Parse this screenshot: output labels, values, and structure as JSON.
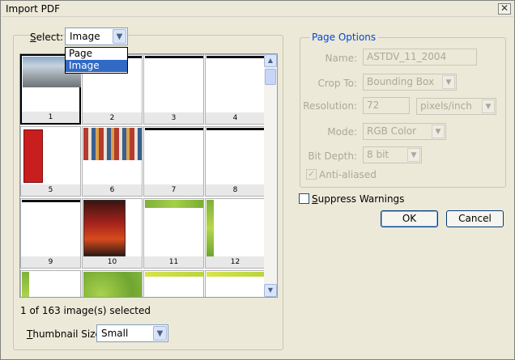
{
  "window": {
    "title": "Import PDF",
    "close_glyph": "✕"
  },
  "select": {
    "label_prefix": "",
    "label_underlined": "S",
    "label_rest": "elect:",
    "value": "Image",
    "options": [
      "Page",
      "Image"
    ],
    "selected_index": 1
  },
  "thumbnails": [
    {
      "num": "1",
      "kind": "photo-building",
      "selected": true
    },
    {
      "num": "2",
      "kind": "blank-bar"
    },
    {
      "num": "3",
      "kind": "blank-bar"
    },
    {
      "num": "4",
      "kind": "blank-bar"
    },
    {
      "num": "5",
      "kind": "red-door"
    },
    {
      "num": "6",
      "kind": "photo-market"
    },
    {
      "num": "7",
      "kind": "blank-bar"
    },
    {
      "num": "8",
      "kind": "blank-bar"
    },
    {
      "num": "9",
      "kind": "blank-bar"
    },
    {
      "num": "10",
      "kind": "poster"
    },
    {
      "num": "11",
      "kind": "green-top"
    },
    {
      "num": "12",
      "kind": "green-left"
    },
    {
      "num": "",
      "kind": "green-left"
    },
    {
      "num": "",
      "kind": "green-full"
    },
    {
      "num": "",
      "kind": "yellow-top"
    },
    {
      "num": "",
      "kind": "yellow-top"
    }
  ],
  "status": "1 of 163 image(s) selected",
  "thumbnail_size": {
    "label_underlined": "T",
    "label_rest": "humbnail Size:",
    "value": "Small"
  },
  "page_options": {
    "legend": "Page Options",
    "name_label": "Name:",
    "name_value": "ASTDV_11_2004",
    "crop_label": "Crop To:",
    "crop_value": "Bounding Box",
    "resolution_label": "Resolution:",
    "resolution_value": "72",
    "resolution_unit": "pixels/inch",
    "mode_label": "Mode:",
    "mode_value": "RGB Color",
    "bitdepth_label": "Bit Depth:",
    "bitdepth_value": "8 bit",
    "antialiased_label": "Anti-aliased"
  },
  "suppress_warnings": {
    "label_underlined": "S",
    "label_rest": "uppress Warnings"
  },
  "buttons": {
    "ok": "OK",
    "cancel": "Cancel"
  }
}
